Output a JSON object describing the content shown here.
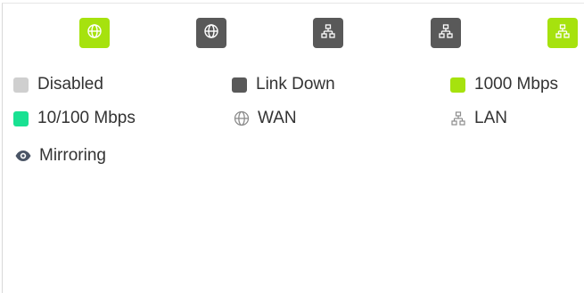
{
  "colors": {
    "disabled": "#cfcfcf",
    "link_down": "#595959",
    "gigabit": "#a6e20e",
    "fast": "#19e192",
    "icon_gray": "#8c8c8c",
    "mirror_icon": "#4a5566"
  },
  "ports": [
    {
      "icon": "globe-icon",
      "state": "gigabit"
    },
    {
      "icon": "globe-icon",
      "state": "link_down"
    },
    {
      "icon": "network-icon",
      "state": "link_down"
    },
    {
      "icon": "network-icon",
      "state": "link_down"
    },
    {
      "icon": "network-icon",
      "state": "gigabit"
    }
  ],
  "legend": {
    "disabled": "Disabled",
    "link_down": "Link Down",
    "gigabit": "1000 Mbps",
    "fast": "10/100 Mbps",
    "wan": "WAN",
    "lan": "LAN",
    "mirroring": "Mirroring"
  }
}
